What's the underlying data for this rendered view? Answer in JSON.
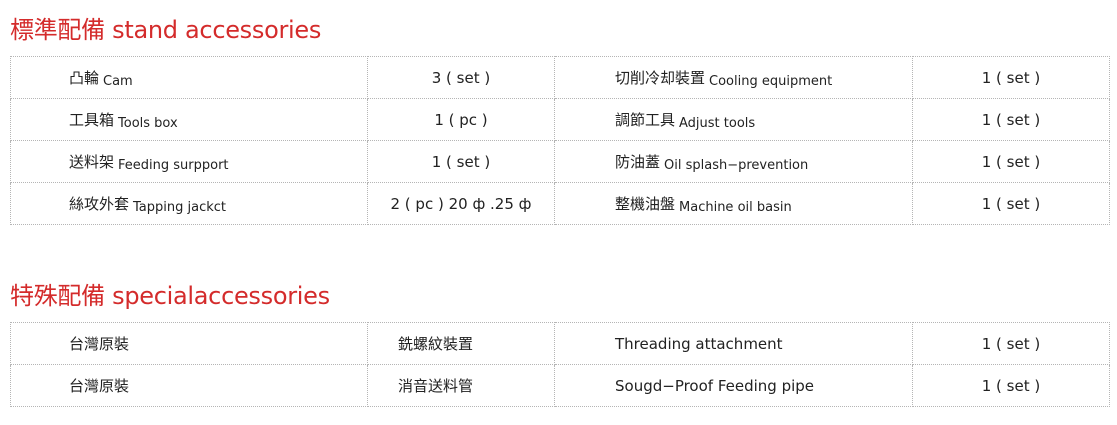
{
  "standard": {
    "title": "標準配備 stand accessories",
    "rows": [
      {
        "c1": "凸輪",
        "c1_en": "Cam",
        "c2": "3 ( set )",
        "c3": "切削冷却裝置",
        "c3_en": "Cooling equipment",
        "c4": "1 ( set )"
      },
      {
        "c1": "工具箱",
        "c1_en": "Tools box",
        "c2": "1 ( pc )",
        "c3": "調節工具",
        "c3_en": "Adjust tools",
        "c4": "1 ( set )"
      },
      {
        "c1": "送料架",
        "c1_en": "Feeding surpport",
        "c2": "1 ( set )",
        "c3": "防油蓋",
        "c3_en": "Oil splash−prevention",
        "c4": "1 ( set )"
      },
      {
        "c1": "絲攻外套",
        "c1_en": "Tapping jackct",
        "c2": "2 ( pc ) 20 ф .25 ф",
        "c3": "整機油盤",
        "c3_en": "Machine oil basin",
        "c4": "1 ( set )"
      }
    ]
  },
  "special": {
    "title": "特殊配備 specialaccessories",
    "rows": [
      {
        "c1": "台灣原裝",
        "c2": "銑螺紋裝置",
        "c3": "Threading attachment",
        "c4": "1 ( set )"
      },
      {
        "c1": "台灣原裝",
        "c2": "消音送料管",
        "c3": "Sougd−Proof Feeding pipe",
        "c4": "1 ( set )"
      }
    ]
  },
  "colors": {
    "heading": "#d42b2b",
    "border": "#b5b5b5"
  }
}
